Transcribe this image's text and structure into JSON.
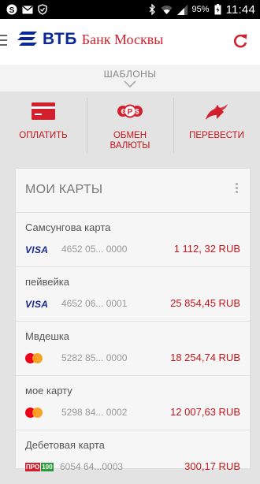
{
  "status_bar": {
    "battery": "95%",
    "time": "11:44",
    "icons": [
      "skype-icon",
      "mail-icon",
      "shield-icon",
      "bluetooth-icon",
      "wifi-icon",
      "signal-icon",
      "battery-icon"
    ]
  },
  "app_bar": {
    "brand": "ВТБ",
    "brand_sub": "Банк Москвы",
    "brand_color": "#0a2896",
    "accent_color": "#d3202f"
  },
  "templates": {
    "label": "ШАБЛОНЫ"
  },
  "actions": [
    {
      "label": "ОПЛАТИТЬ",
      "icon": "card-icon"
    },
    {
      "label_line1": "ОБМЕН",
      "label_line2": "ВАЛЮТЫ",
      "icon": "currency-exchange-icon"
    },
    {
      "label": "ПЕРЕВЕСТИ",
      "icon": "transfer-icon"
    }
  ],
  "cards": {
    "title": "МОИ КАРТЫ",
    "items": [
      {
        "name": "Самсунгова карта",
        "type": "VISA",
        "number": "4652 05... 0000",
        "amount": "1 112, 32 RUB"
      },
      {
        "name": "пейвейка",
        "type": "VISA",
        "number": "4652 06... 0001",
        "amount": "25 854,45 RUB"
      },
      {
        "name": "Мвдешка",
        "type": "MasterCard",
        "number": "5282 85... 0000",
        "amount": "18 254,74 RUB"
      },
      {
        "name": "мое карту",
        "type": "MasterCard",
        "number": "5298 84... 0002",
        "amount": "12 007,63 RUB"
      },
      {
        "name": "Дебетовая карта",
        "type": "ПРО100",
        "type_part1": "ПРО",
        "type_part2": "100",
        "number": "6054 64...0003",
        "amount": "300,17 RUB"
      }
    ]
  }
}
